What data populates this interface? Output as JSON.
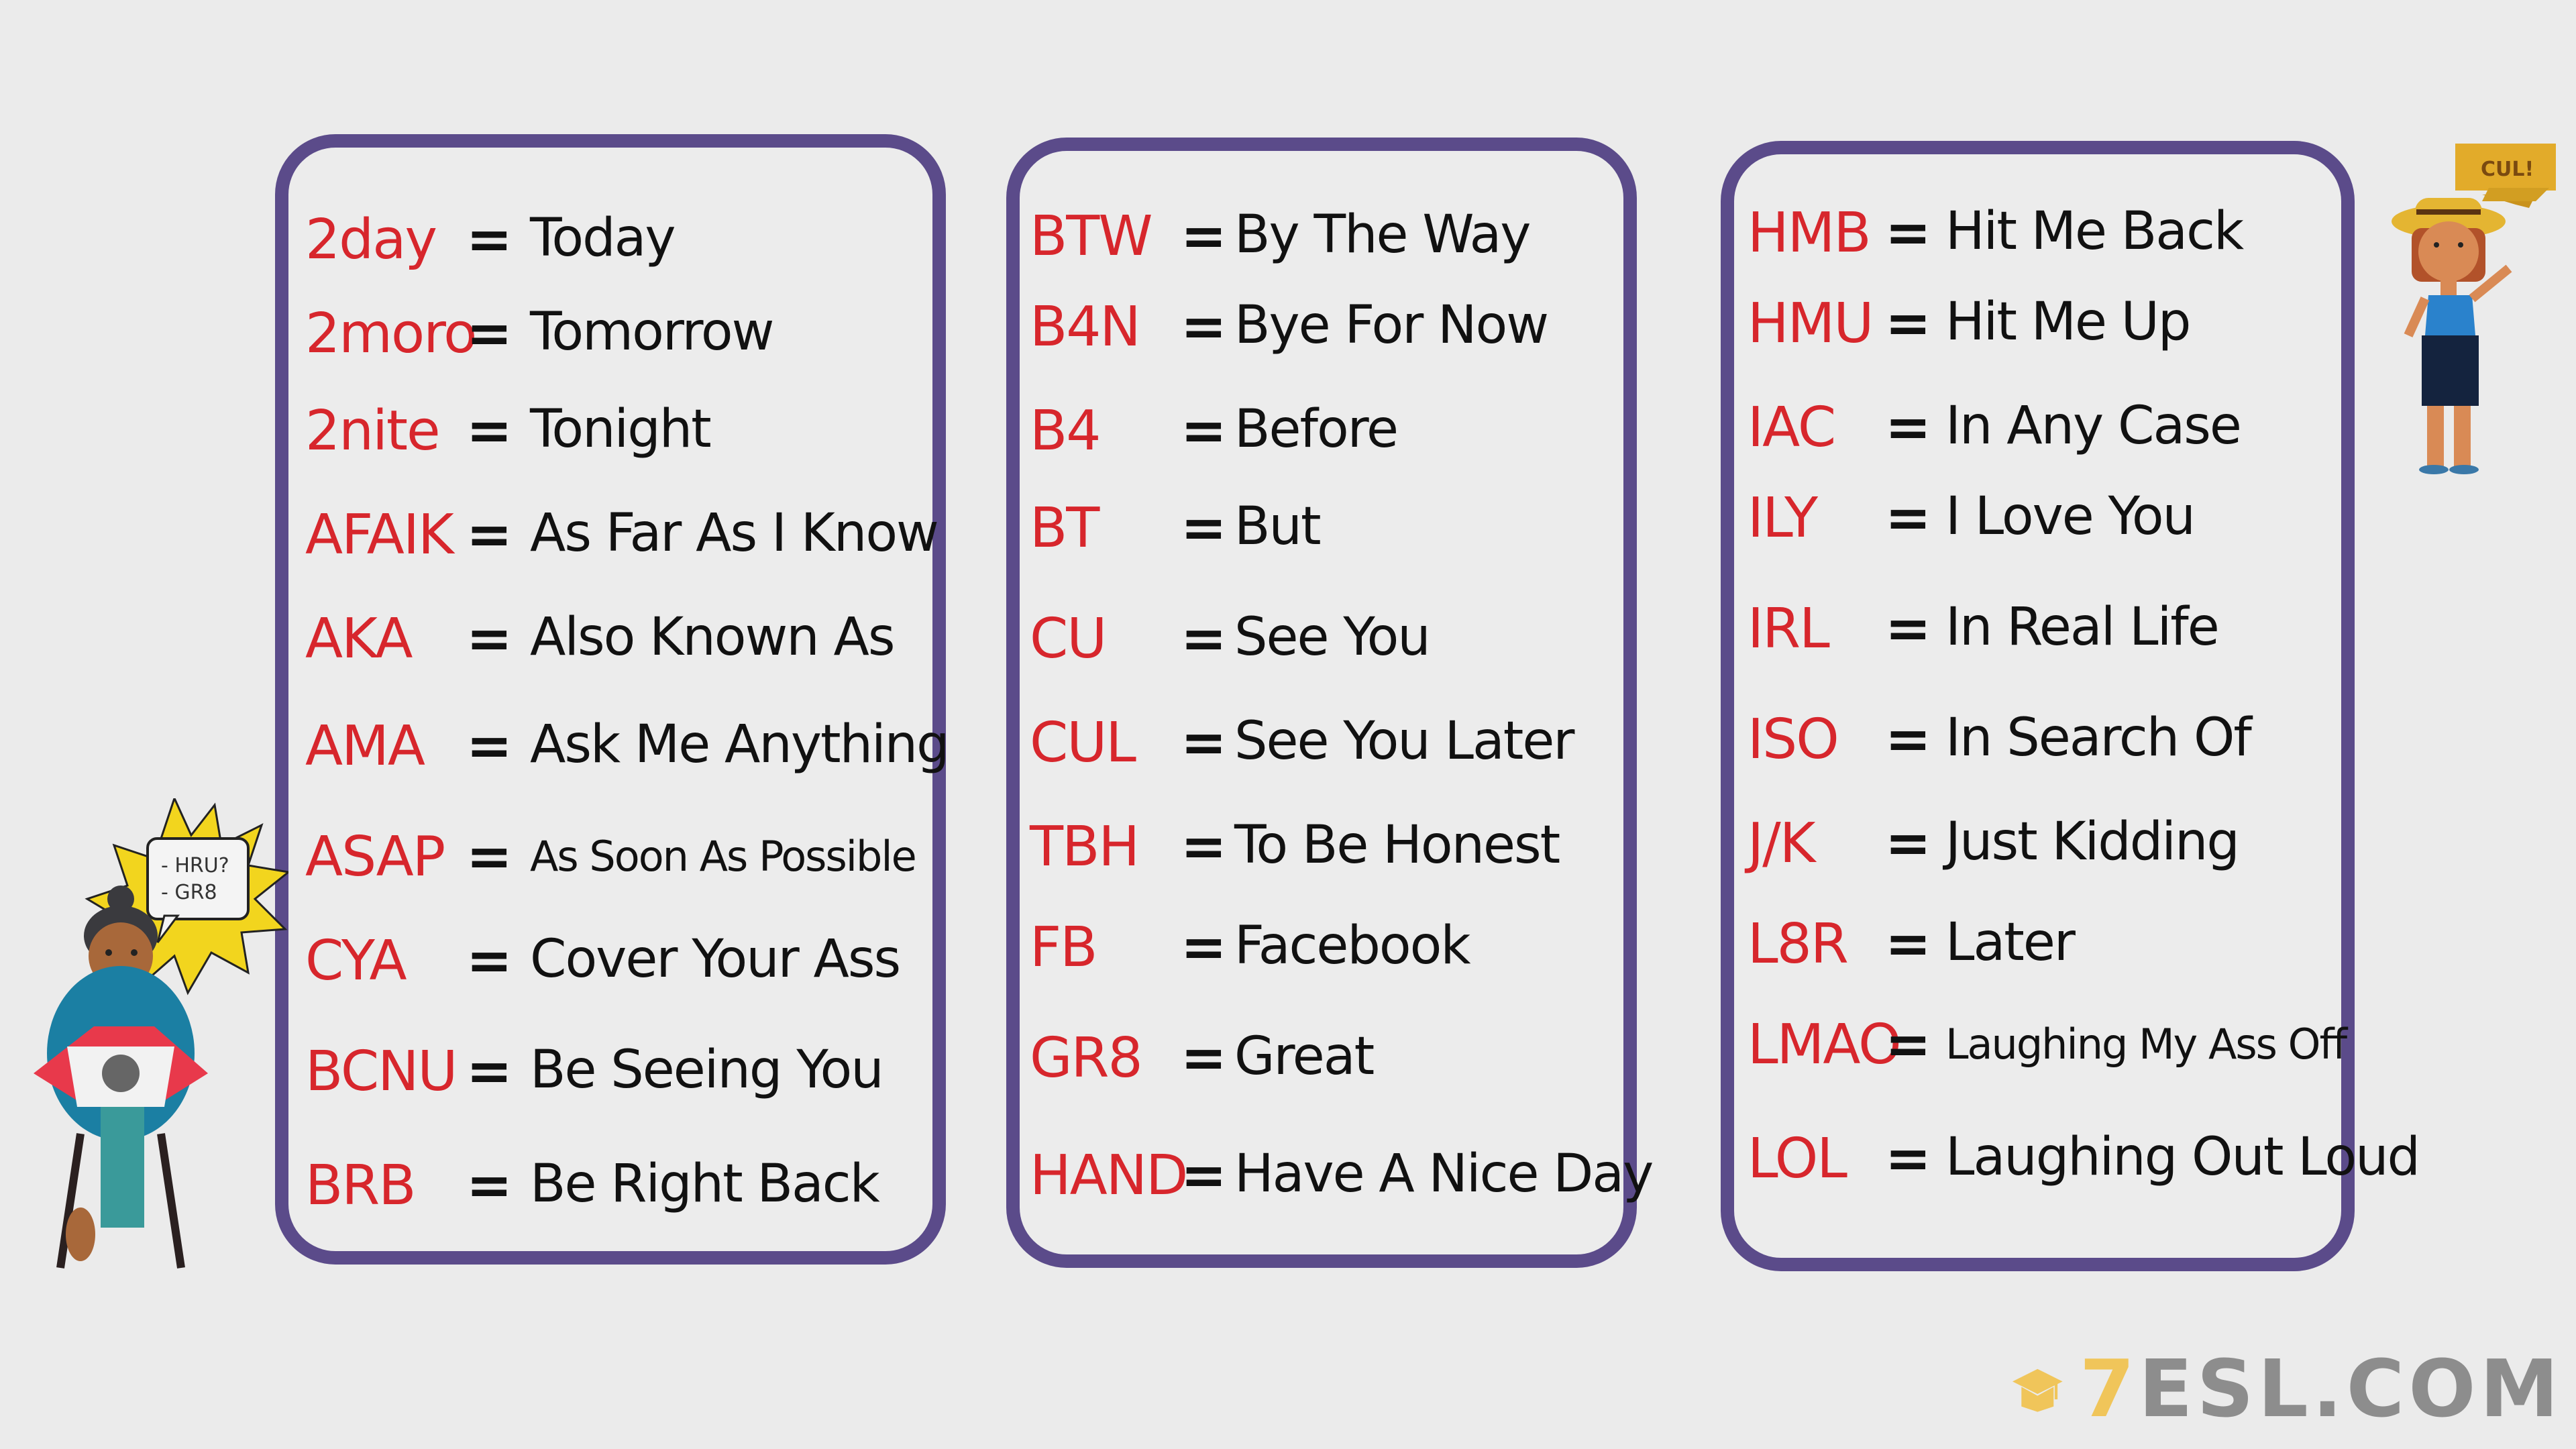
{
  "colors": {
    "background": "#ebebeb",
    "card_border": "#5b4b8a",
    "abbreviation": "#d7262c",
    "meaning": "#111111",
    "logo_gray": "#8d8d8d",
    "logo_yellow": "#f0c55a"
  },
  "equals_sign": "=",
  "columns": [
    {
      "items": [
        {
          "abbr": "2day",
          "meaning": "Today"
        },
        {
          "abbr": "2moro",
          "meaning": "Tomorrow"
        },
        {
          "abbr": "2nite",
          "meaning": "Tonight"
        },
        {
          "abbr": "AFAIK",
          "meaning": "As Far As I Know"
        },
        {
          "abbr": "AKA",
          "meaning": "Also Known As"
        },
        {
          "abbr": "AMA",
          "meaning": "Ask Me Anything"
        },
        {
          "abbr": "ASAP",
          "meaning": "As Soon As Possible"
        },
        {
          "abbr": "CYA",
          "meaning": "Cover Your Ass"
        },
        {
          "abbr": "BCNU",
          "meaning": "Be Seeing You"
        },
        {
          "abbr": "BRB",
          "meaning": "Be Right Back"
        }
      ]
    },
    {
      "items": [
        {
          "abbr": "BTW",
          "meaning": "By The Way"
        },
        {
          "abbr": "B4N",
          "meaning": "Bye For Now"
        },
        {
          "abbr": "B4",
          "meaning": "Before"
        },
        {
          "abbr": "BT",
          "meaning": "But"
        },
        {
          "abbr": "CU",
          "meaning": "See You"
        },
        {
          "abbr": "CUL",
          "meaning": "See You Later"
        },
        {
          "abbr": "TBH",
          "meaning": "To Be Honest"
        },
        {
          "abbr": "FB",
          "meaning": "Facebook"
        },
        {
          "abbr": "GR8",
          "meaning": "Great"
        },
        {
          "abbr": "HAND",
          "meaning": "Have A Nice Day"
        }
      ]
    },
    {
      "items": [
        {
          "abbr": "HMB",
          "meaning": "Hit Me Back"
        },
        {
          "abbr": "HMU",
          "meaning": "Hit Me Up"
        },
        {
          "abbr": "IAC",
          "meaning": "In Any Case"
        },
        {
          "abbr": "ILY",
          "meaning": "I Love You"
        },
        {
          "abbr": "IRL",
          "meaning": "In Real Life"
        },
        {
          "abbr": "ISO",
          "meaning": "In Search Of"
        },
        {
          "abbr": "J/K",
          "meaning": "Just Kidding"
        },
        {
          "abbr": "L8R",
          "meaning": "Later"
        },
        {
          "abbr": "LMAO",
          "meaning": "Laughing My Ass Off"
        },
        {
          "abbr": "LOL",
          "meaning": "Laughing Out Loud"
        }
      ]
    }
  ],
  "left_character": {
    "speech_lines": [
      "- HRU?",
      "- GR8"
    ]
  },
  "right_character": {
    "banner_text": "CUL!"
  },
  "logo": {
    "seven": "7",
    "text": "ESL.COM"
  }
}
